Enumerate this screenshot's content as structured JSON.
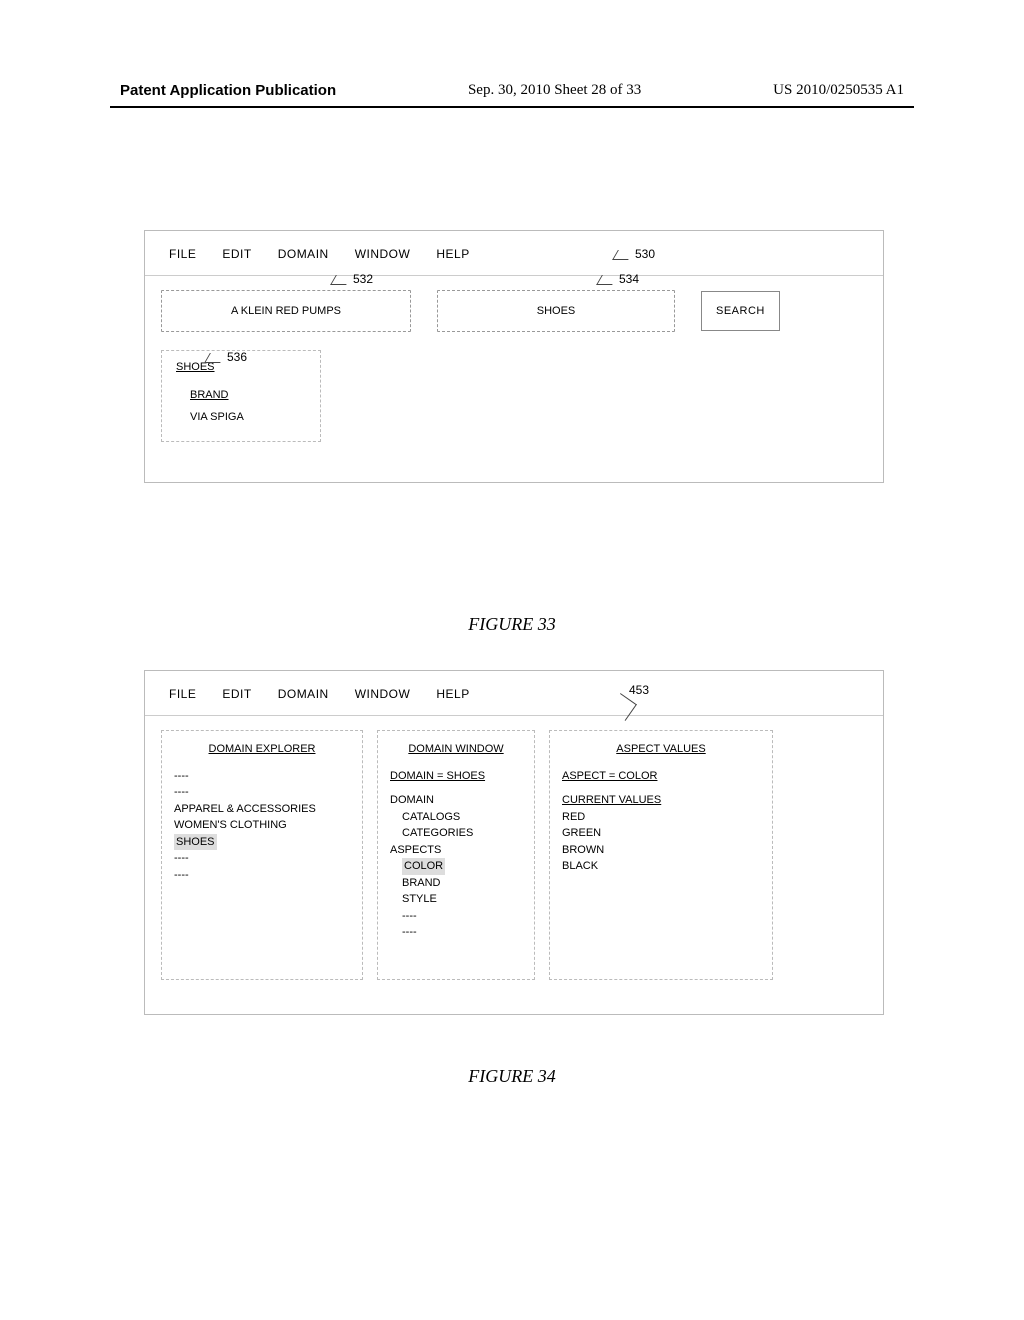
{
  "header": {
    "left": "Patent Application Publication",
    "center": "Sep. 30, 2010  Sheet 28 of 33",
    "right": "US 2010/0250535 A1"
  },
  "fig33": {
    "menubar": [
      "FILE",
      "EDIT",
      "DOMAIN",
      "WINDOW",
      "HELP"
    ],
    "ref_window": "530",
    "input_left_value": "A KLEIN RED PUMPS",
    "ref_input_left": "532",
    "input_right_value": "SHOES",
    "ref_input_right": "534",
    "search_label": "SEARCH",
    "ref_panel": "536",
    "panel_title": "SHOES",
    "panel_subtitle": "BRAND",
    "panel_value": "VIA SPIGA",
    "caption": "FIGURE 33"
  },
  "fig34": {
    "menubar": [
      "FILE",
      "EDIT",
      "DOMAIN",
      "WINDOW",
      "HELP"
    ],
    "ref_window": "453",
    "explorer": {
      "head": "DOMAIN EXPLORER",
      "placeholders_top": [
        "----",
        "----"
      ],
      "items": [
        "APPAREL & ACCESSORIES",
        "WOMEN'S CLOTHING"
      ],
      "selected": "SHOES",
      "placeholders_bottom": [
        "----",
        "----"
      ]
    },
    "domain_window": {
      "head": "DOMAIN WINDOW",
      "domain_line": "DOMAIN = SHOES",
      "group_label": "DOMAIN",
      "sub1": "CATALOGS",
      "sub2": "CATEGORIES",
      "aspects_label": "ASPECTS",
      "aspect_selected": "COLOR",
      "aspects_rest": [
        "BRAND",
        "STYLE"
      ],
      "trailing": [
        "----",
        "----"
      ]
    },
    "aspect_values": {
      "head": "ASPECT VALUES",
      "aspect_line": "ASPECT = COLOR",
      "current_label": "CURRENT VALUES",
      "values": [
        "RED",
        "GREEN",
        "BROWN",
        "BLACK"
      ]
    },
    "caption": "FIGURE 34"
  }
}
